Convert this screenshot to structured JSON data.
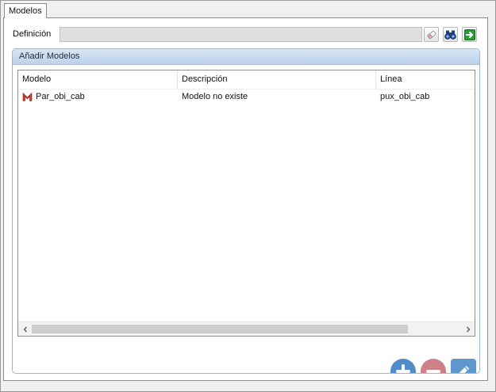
{
  "tab": {
    "label": "Modelos"
  },
  "definition": {
    "label": "Definición",
    "value": "",
    "placeholder": ""
  },
  "toolbar": {
    "clear_icon": "eraser-icon",
    "search_icon": "binoculars-icon",
    "go_icon": "green-arrow-right-icon"
  },
  "group": {
    "title": "Añadir Modelos"
  },
  "table": {
    "columns": [
      "Modelo",
      "Descripción",
      "Línea"
    ],
    "rows": [
      {
        "icon": "model-m-icon",
        "modelo": "Par_obi_cab",
        "descripcion": "Modelo no existe",
        "linea": "pux_obi_cab"
      }
    ]
  },
  "actions": {
    "add_icon": "plus-circle-icon",
    "remove_icon": "minus-circle-icon",
    "edit_icon": "pencil-icon"
  },
  "colors": {
    "header_blue": "#bcd1ea",
    "add_button": "#4f8cc9",
    "remove_button": "#cf7f86",
    "edit_button": "#5d97cd",
    "go_button": "#2e9b3a",
    "model_icon": "#d83a2c"
  }
}
